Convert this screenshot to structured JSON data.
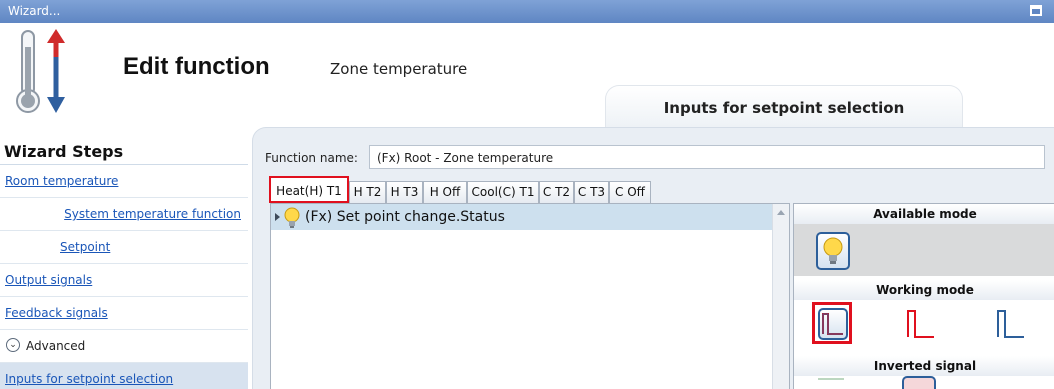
{
  "window": {
    "title": "Wizard..."
  },
  "header": {
    "title": "Edit function",
    "subtitle": "Zone temperature",
    "step_tab": "Inputs for setpoint selection"
  },
  "sidebar": {
    "title": "Wizard Steps",
    "items": [
      {
        "label": "Room temperature"
      },
      {
        "label": "System temperature function"
      },
      {
        "label": "Setpoint"
      },
      {
        "label": "Output signals"
      },
      {
        "label": "Feedback signals"
      },
      {
        "label": "Advanced"
      },
      {
        "label": "Inputs for setpoint selection"
      }
    ]
  },
  "form": {
    "function_name_label": "Function name:",
    "function_name_value": "(Fx) Root - Zone temperature"
  },
  "tabs": [
    {
      "label": "Heat(H) T1"
    },
    {
      "label": "H T2"
    },
    {
      "label": "H T3"
    },
    {
      "label": "H Off"
    },
    {
      "label": "Cool(C) T1"
    },
    {
      "label": "C T2"
    },
    {
      "label": "C T3"
    },
    {
      "label": "C Off"
    }
  ],
  "inputs_list": [
    {
      "label": "(Fx) Set point change.Status"
    }
  ],
  "mode_panel": {
    "available_mode": "Available mode",
    "working_mode": "Working mode",
    "inverted_signal": "Inverted signal"
  },
  "colors": {
    "accent_blue": "#2d5f9a",
    "highlight_red": "#e0101e",
    "selected_row": "#cde0ee",
    "link": "#1a56b8"
  }
}
